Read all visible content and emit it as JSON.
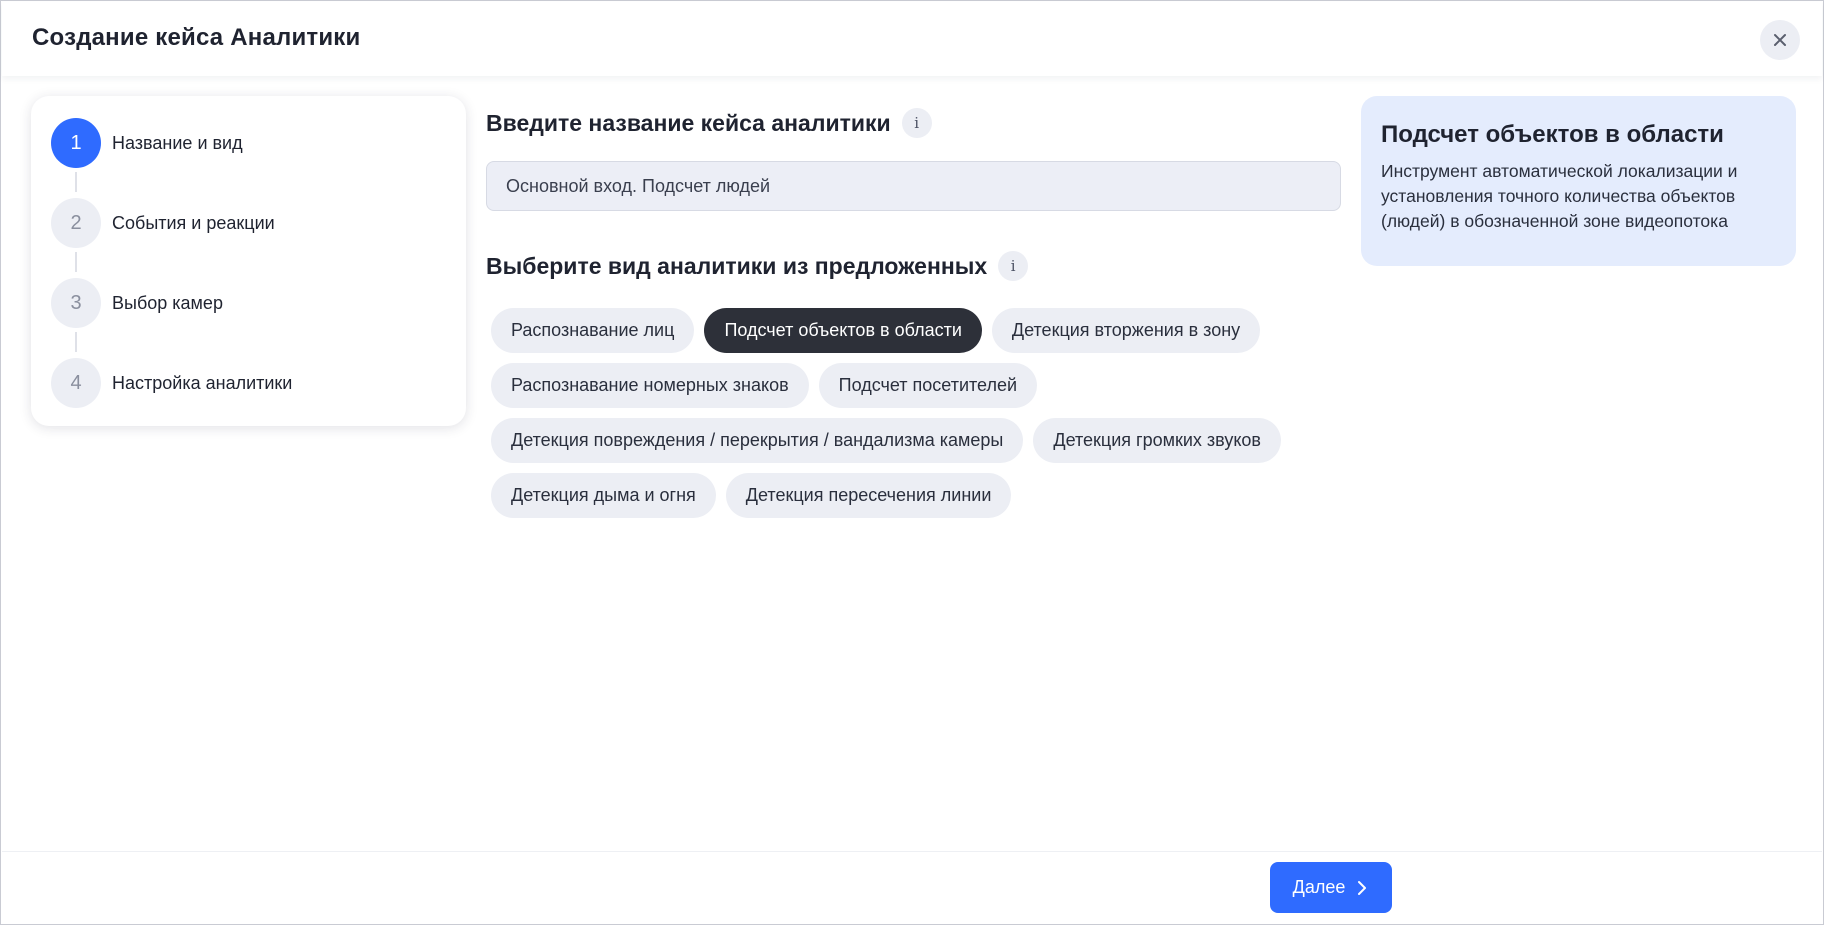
{
  "header": {
    "title": "Создание кейса Аналитики",
    "close_icon": "close-icon"
  },
  "stepper": {
    "active_index": 0,
    "steps": [
      {
        "number": "1",
        "label": "Название и вид"
      },
      {
        "number": "2",
        "label": "События и реакции"
      },
      {
        "number": "3",
        "label": "Выбор камер"
      },
      {
        "number": "4",
        "label": "Настройка аналитики"
      }
    ]
  },
  "name_section": {
    "title": "Введите название кейса аналитики",
    "info_icon": "i",
    "input_value": "Основной вход. Подсчет людей"
  },
  "type_section": {
    "title": "Выберите вид аналитики из предложенных",
    "info_icon": "i",
    "selected": "Подсчет объектов в области",
    "rows": [
      [
        "Распознавание лиц",
        "Подсчет объектов в области",
        "Детекция вторжения в зону"
      ],
      [
        "Распознавание номерных знаков",
        "Подсчет посетителей"
      ],
      [
        "Детекция повреждения / перекрытия / вандализма камеры",
        "Детекция громких звуков"
      ],
      [
        "Детекция дыма и огня",
        "Детекция пересечения линии"
      ]
    ]
  },
  "info_card": {
    "title": "Подсчет объектов в области",
    "text": "Инструмент автоматической локализации и установления точного количества объектов (людей) в обозначенной зоне видеопотока"
  },
  "footer": {
    "next_label": "Далее",
    "next_icon": "chevron-right-icon"
  },
  "colors": {
    "accent": "#2f6bff",
    "chip_selected": "#2d3039",
    "chip_default": "#eceef4",
    "info_card_bg": "#e4ecfd"
  }
}
